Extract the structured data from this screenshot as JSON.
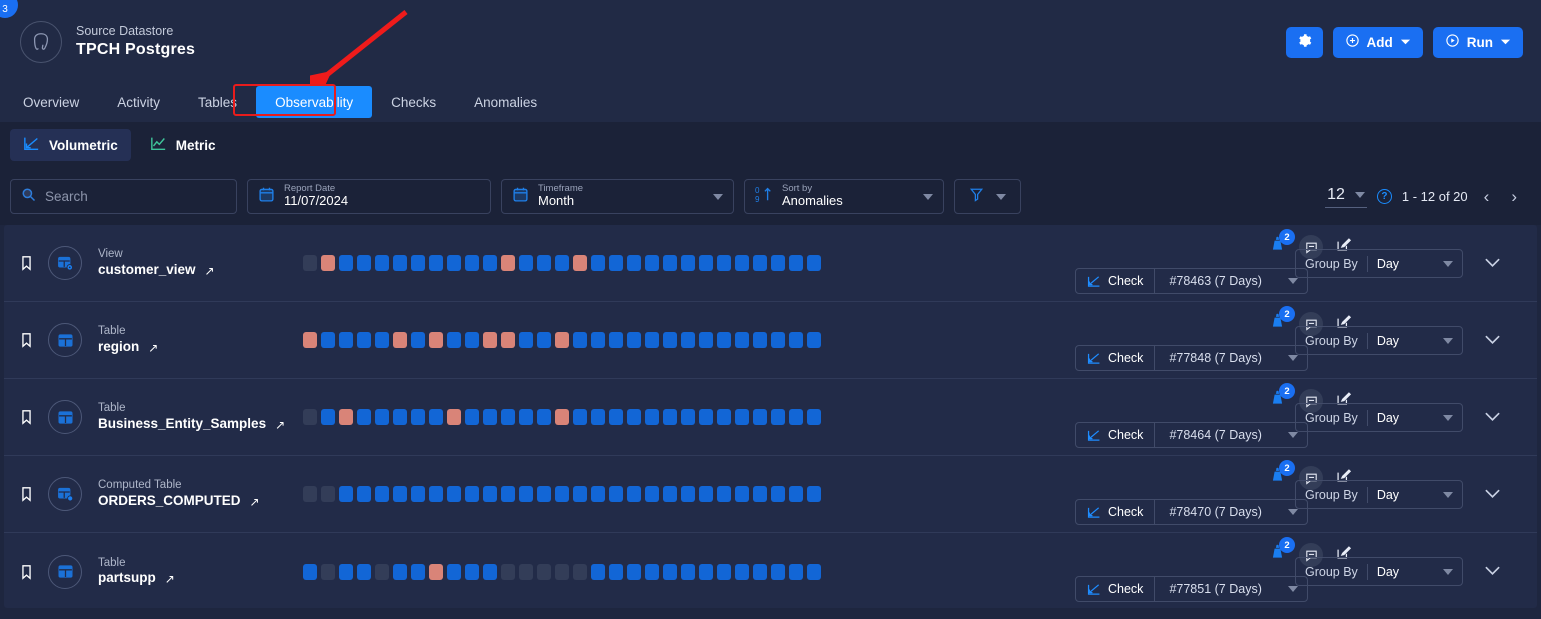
{
  "header": {
    "corner_badge": "3",
    "datastore_kind": "Source Datastore",
    "datastore_name": "TPCH Postgres",
    "logo_icon": "postgres-elephant-icon",
    "settings_label": "settings-gear-icon",
    "add_label": "Add",
    "run_label": "Run"
  },
  "nav": {
    "tabs": [
      {
        "label": "Overview",
        "active": false
      },
      {
        "label": "Activity",
        "active": false
      },
      {
        "label": "Tables",
        "active": false
      },
      {
        "label": "Observability",
        "active": true
      },
      {
        "label": "Checks",
        "active": false
      },
      {
        "label": "Anomalies",
        "active": false
      }
    ],
    "highlight_color": "#e81c1c",
    "active_color": "#1a8cff"
  },
  "subtabs": [
    {
      "label": "Volumetric",
      "icon": "volumetric-chart-icon",
      "active": true
    },
    {
      "label": "Metric",
      "icon": "metric-line-chart-icon",
      "active": false
    }
  ],
  "filters": {
    "search_placeholder": "Search",
    "search_value": "",
    "report_date": {
      "label": "Report Date",
      "value": "11/07/2024"
    },
    "timeframe": {
      "label": "Timeframe",
      "value": "Month"
    },
    "sort_by": {
      "label": "Sort by",
      "value": "Anomalies"
    },
    "filter_icon": "funnel-filter-icon"
  },
  "pagination": {
    "page_size": "12",
    "help_icon": "?",
    "range": "1 - 12 of 20",
    "prev": "‹",
    "next": "›"
  },
  "rows": [
    {
      "type": "View",
      "name": "customer_view",
      "type_icon": "view-table-icon",
      "alerts": "2",
      "check_label": "Check",
      "check_id": "#78463 (7 Days)",
      "group_by_label": "Group By",
      "group_by_value": "Day",
      "cells": [
        "none",
        "anom",
        "ok",
        "ok",
        "ok",
        "ok",
        "ok",
        "ok",
        "ok",
        "ok",
        "ok",
        "anom",
        "ok",
        "ok",
        "ok",
        "anom",
        "ok",
        "ok",
        "ok",
        "ok",
        "ok",
        "ok",
        "ok",
        "ok",
        "ok",
        "ok",
        "ok",
        "ok",
        "ok"
      ]
    },
    {
      "type": "Table",
      "name": "region",
      "type_icon": "table-icon",
      "alerts": "2",
      "check_label": "Check",
      "check_id": "#77848 (7 Days)",
      "group_by_label": "Group By",
      "group_by_value": "Day",
      "cells": [
        "anom",
        "ok",
        "ok",
        "ok",
        "ok",
        "anom",
        "ok",
        "anom",
        "ok",
        "ok",
        "anom",
        "anom",
        "ok",
        "ok",
        "anom",
        "ok",
        "ok",
        "ok",
        "ok",
        "ok",
        "ok",
        "ok",
        "ok",
        "ok",
        "ok",
        "ok",
        "ok",
        "ok",
        "ok"
      ]
    },
    {
      "type": "Table",
      "name": "Business_Entity_Samples",
      "type_icon": "table-icon",
      "alerts": "2",
      "check_label": "Check",
      "check_id": "#78464 (7 Days)",
      "group_by_label": "Group By",
      "group_by_value": "Day",
      "cells": [
        "none",
        "ok",
        "anom",
        "ok",
        "ok",
        "ok",
        "ok",
        "ok",
        "anom",
        "ok",
        "ok",
        "ok",
        "ok",
        "ok",
        "anom",
        "ok",
        "ok",
        "ok",
        "ok",
        "ok",
        "ok",
        "ok",
        "ok",
        "ok",
        "ok",
        "ok",
        "ok",
        "ok",
        "ok"
      ]
    },
    {
      "type": "Computed Table",
      "name": "ORDERS_COMPUTED",
      "type_icon": "computed-table-icon",
      "alerts": "2",
      "check_label": "Check",
      "check_id": "#78470 (7 Days)",
      "group_by_label": "Group By",
      "group_by_value": "Day",
      "cells": [
        "none",
        "none",
        "ok",
        "ok",
        "ok",
        "ok",
        "ok",
        "ok",
        "ok",
        "ok",
        "ok",
        "ok",
        "ok",
        "ok",
        "ok",
        "ok",
        "ok",
        "ok",
        "ok",
        "ok",
        "ok",
        "ok",
        "ok",
        "ok",
        "ok",
        "ok",
        "ok",
        "ok",
        "ok"
      ]
    },
    {
      "type": "Table",
      "name": "partsupp",
      "type_icon": "table-icon",
      "alerts": "2",
      "check_label": "Check",
      "check_id": "#77851 (7 Days)",
      "group_by_label": "Group By",
      "group_by_value": "Day",
      "cells": [
        "ok",
        "none",
        "ok",
        "ok",
        "none",
        "ok",
        "ok",
        "anom",
        "ok",
        "ok",
        "ok",
        "none",
        "none",
        "none",
        "none",
        "none",
        "ok",
        "ok",
        "ok",
        "ok",
        "ok",
        "ok",
        "ok",
        "ok",
        "ok",
        "ok",
        "ok",
        "ok",
        "ok"
      ]
    }
  ],
  "colors": {
    "ok": "#1266d6",
    "anomaly": "#d98478",
    "empty": "#333d58",
    "accent": "#1a6ff2",
    "panel": "#222b48",
    "background": "#1b2238"
  }
}
